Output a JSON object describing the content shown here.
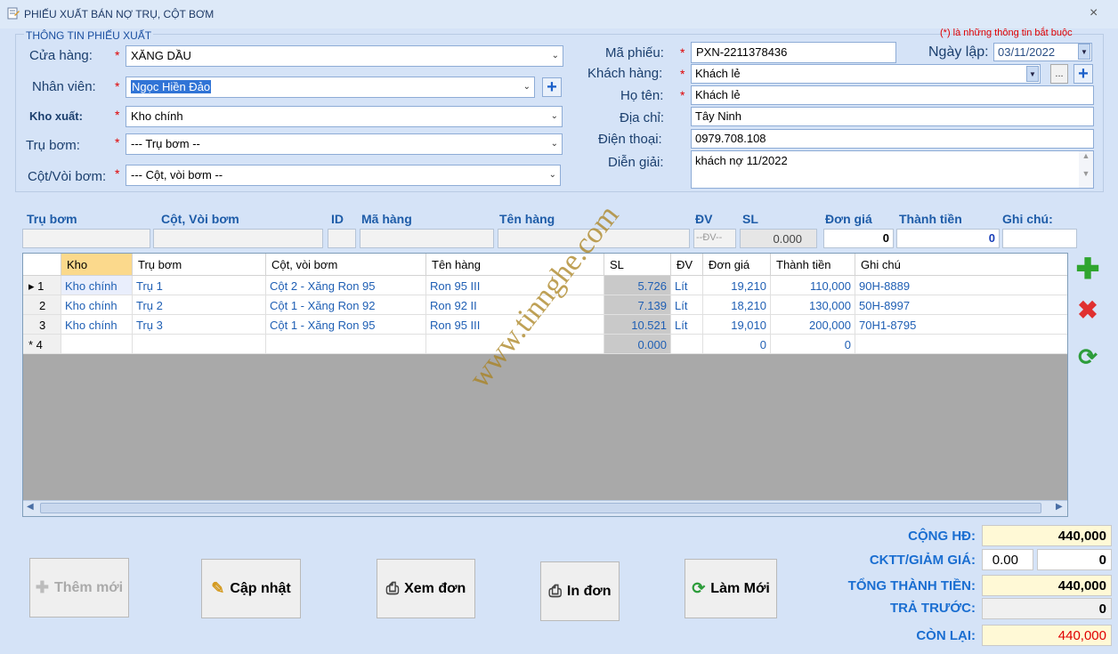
{
  "window": {
    "title": "PHIẾU XUẤT BÁN  NỢ TRỤ, CỘT BƠM",
    "close_glyph": "×"
  },
  "group_title": "THÔNG TIN PHIẾU XUẤT",
  "required_note": "(*) là những thông tin bắt buộc",
  "required_mark": "*",
  "left_form": {
    "store": {
      "label": "Cửa hàng:",
      "value": "XĂNG DẦU"
    },
    "employee": {
      "label": "Nhân viên:",
      "value": "Ngọc Hiền Đảo"
    },
    "warehouse": {
      "label": "Kho xuất:",
      "value": "Kho chính"
    },
    "pump": {
      "label": "Trụ bơm:",
      "value": "--- Trụ bơm --"
    },
    "nozzle": {
      "label": "Cột/Vòi bơm:",
      "value": "--- Cột, vòi bơm --"
    }
  },
  "right_form": {
    "receipt_no": {
      "label": "Mã phiếu:",
      "value": "PXN-2211378436"
    },
    "date": {
      "label": "Ngày lập:",
      "value": "03/11/2022"
    },
    "customer": {
      "label": "Khách hàng:",
      "value": "Khách lẻ",
      "browse": "..."
    },
    "full_name": {
      "label": "Họ tên:",
      "value": "Khách lẻ"
    },
    "address": {
      "label": "Địa chỉ:",
      "value": "Tây Ninh"
    },
    "phone": {
      "label": "Điện thoại:",
      "value": "0979.708.108"
    },
    "description": {
      "label": "Diễn giải:",
      "value": "khách nợ 11/2022"
    }
  },
  "entry_row": {
    "headers": {
      "pump": "Trụ bơm",
      "nozzle": "Cột, Vòi bơm",
      "id": "ID",
      "code": "Mã hàng",
      "name": "Tên hàng",
      "unit": "ĐV",
      "qty": "SL",
      "price": "Đơn giá",
      "amount": "Thành tiền",
      "note": "Ghi chú:"
    },
    "unit_value": "--ĐV--",
    "qty_value": "0.000",
    "price_value": "0",
    "amount_value": "0"
  },
  "grid": {
    "columns": [
      "Kho",
      "Trụ bơm",
      "Cột, vòi bơm",
      "Tên hàng",
      "SL",
      "ĐV",
      "Đơn giá",
      "Thành tiền",
      "Ghi chú"
    ],
    "rows": [
      {
        "no": "1",
        "kho": "Kho chính",
        "tru": "Trụ 1",
        "cot": "Cột 2 - Xăng Ron 95",
        "ten": "Ron 95 III",
        "sl": "5.726",
        "dv": "Lít",
        "gia": "19,210",
        "tien": "110,000",
        "ghichu": "90H-8889"
      },
      {
        "no": "2",
        "kho": "Kho chính",
        "tru": "Trụ 2",
        "cot": "Cột 1 -  Xăng Ron 92",
        "ten": "Ron 92 II",
        "sl": "7.139",
        "dv": "Lít",
        "gia": "18,210",
        "tien": "130,000",
        "ghichu": "50H-8997"
      },
      {
        "no": "3",
        "kho": "Kho chính",
        "tru": "Trụ 3",
        "cot": "Cột 1 -  Xăng Ron 95",
        "ten": "Ron 95 III",
        "sl": "10.521",
        "dv": "Lít",
        "gia": "19,010",
        "tien": "200,000",
        "ghichu": "70H1-8795"
      }
    ],
    "new_row": {
      "no": "4",
      "sl": "0.000",
      "gia": "0",
      "tien": "0"
    }
  },
  "buttons": {
    "add_new": "Thêm mới",
    "update": "Cập nhật",
    "view": "Xem đơn",
    "print": "In đơn",
    "refresh": "Làm Mới"
  },
  "summary": {
    "total_label": "CỘNG HĐ:",
    "total_value": "440,000",
    "discount_label": "CKTT/GIẢM GIÁ:",
    "discount_pct": "0.00",
    "discount_value": "0",
    "grand_label": "TỔNG THÀNH TIỀN:",
    "grand_value": "440,000",
    "prepaid_label": "TRẢ TRƯỚC:",
    "prepaid_value": "0",
    "remaining_label": "CÒN LẠI:",
    "remaining_value": "440,000"
  },
  "watermark": "www.tinnghe.com",
  "colors": {
    "background": "#d5e3f7",
    "label": "#1b3f6e",
    "sum_label": "#1a6ed1",
    "required": "#e00000",
    "grid_text": "#1f5fb4"
  }
}
